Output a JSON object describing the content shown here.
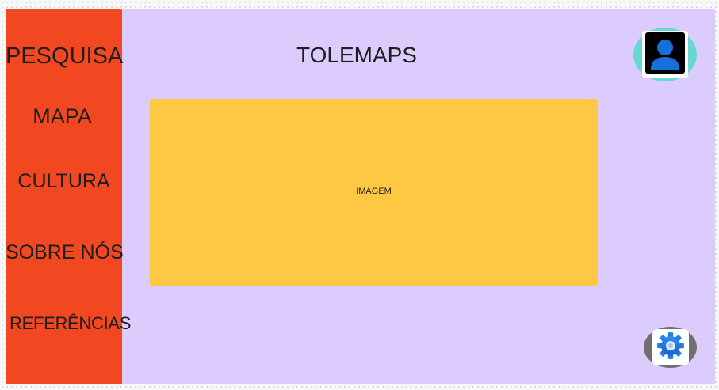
{
  "app": {
    "title": "TOLEMAPS"
  },
  "sidebar": {
    "items": [
      {
        "label": "PESQUISA"
      },
      {
        "label": "MAPA"
      },
      {
        "label": "CULTURA"
      },
      {
        "label": "SOBRE NÓS"
      },
      {
        "label": "REFERÊNCIAS"
      }
    ]
  },
  "main": {
    "image_placeholder": "IMAGEM"
  },
  "icons": {
    "profile": "user-profile-icon",
    "settings": "gear-icon"
  },
  "colors": {
    "sidebar": "#f24822",
    "background": "#dccbfd",
    "image_box": "#ffc843",
    "profile_button": "#66d8cf",
    "settings_button": "#6f6f6f",
    "icon_blue": "#1770d8"
  }
}
